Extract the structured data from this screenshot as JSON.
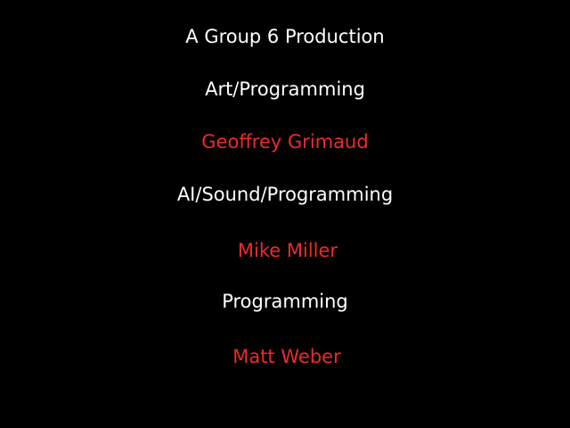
{
  "credits": {
    "heading": "A Group 6 Production",
    "entries": [
      {
        "role": "Art/Programming",
        "name": "Geoffrey Grimaud"
      },
      {
        "role": "AI/Sound/Programming",
        "name": "Mike Miller"
      },
      {
        "role": "Programming",
        "name": "Matt Weber"
      }
    ]
  },
  "colors": {
    "background": "#000000",
    "role_text": "#ffffff",
    "name_text": "#ee2a2a"
  }
}
